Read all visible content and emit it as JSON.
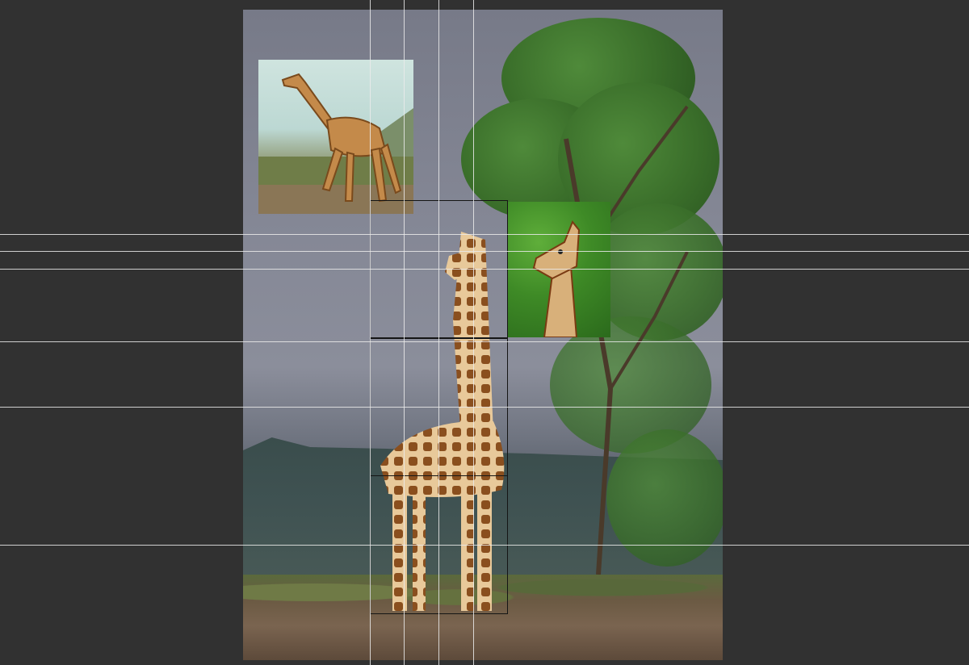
{
  "workspace": {
    "background_color": "#313131",
    "guide_color": "#ebebeb",
    "selection_color": "#151515"
  },
  "canvas": {
    "main_image": "giraffe-under-tree-photo",
    "inset_images": [
      "walking-giraffe-photo",
      "giraffe-head-green-background-photo"
    ]
  }
}
